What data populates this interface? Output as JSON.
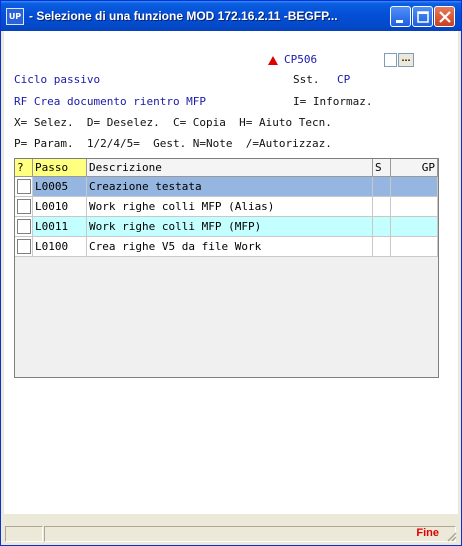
{
  "window": {
    "title": " - Selezione di una funzione MOD 172.16.2.11 -BEGFP...",
    "app_icon": "UP"
  },
  "header": {
    "code": "CP506",
    "ciclo": "Ciclo passivo",
    "sst": "Sst.",
    "sst_value": "CP",
    "function_line": "RF Crea documento rientro MFP",
    "info_line": "I= Informaz.",
    "legend_line1": "X= Selez.  D= Deselez.  C= Copia  H= Aiuto Tecn.",
    "legend_line2": "P= Param.  1/2/4/5=  Gest. N=Note  /=Autorizzaz.",
    "lookup_button": "..."
  },
  "grid": {
    "columns": [
      "?",
      "Passo",
      "Descrizione",
      "S",
      "GP"
    ],
    "rows": [
      {
        "passo": "L0005",
        "descrizione": "Creazione testata"
      },
      {
        "passo": "L0010",
        "descrizione": "Work righe colli MFP (Alias)"
      },
      {
        "passo": "L0011",
        "descrizione": "Work righe colli MFP (MFP)"
      },
      {
        "passo": "L0100",
        "descrizione": "Crea righe V5 da file Work"
      }
    ]
  },
  "toolbar": {
    "icons": [
      "arrow-up-icon",
      "arrow-down-icon",
      "play-icon",
      "delete-icon",
      "refresh-icon",
      "info-icon"
    ]
  },
  "status": {
    "fine": "Fine"
  },
  "colors": {
    "selected_row": "#94b6e0",
    "highlight_row": "#c4ffff",
    "blue_text": "#1a1aa8",
    "red": "#e00000"
  }
}
